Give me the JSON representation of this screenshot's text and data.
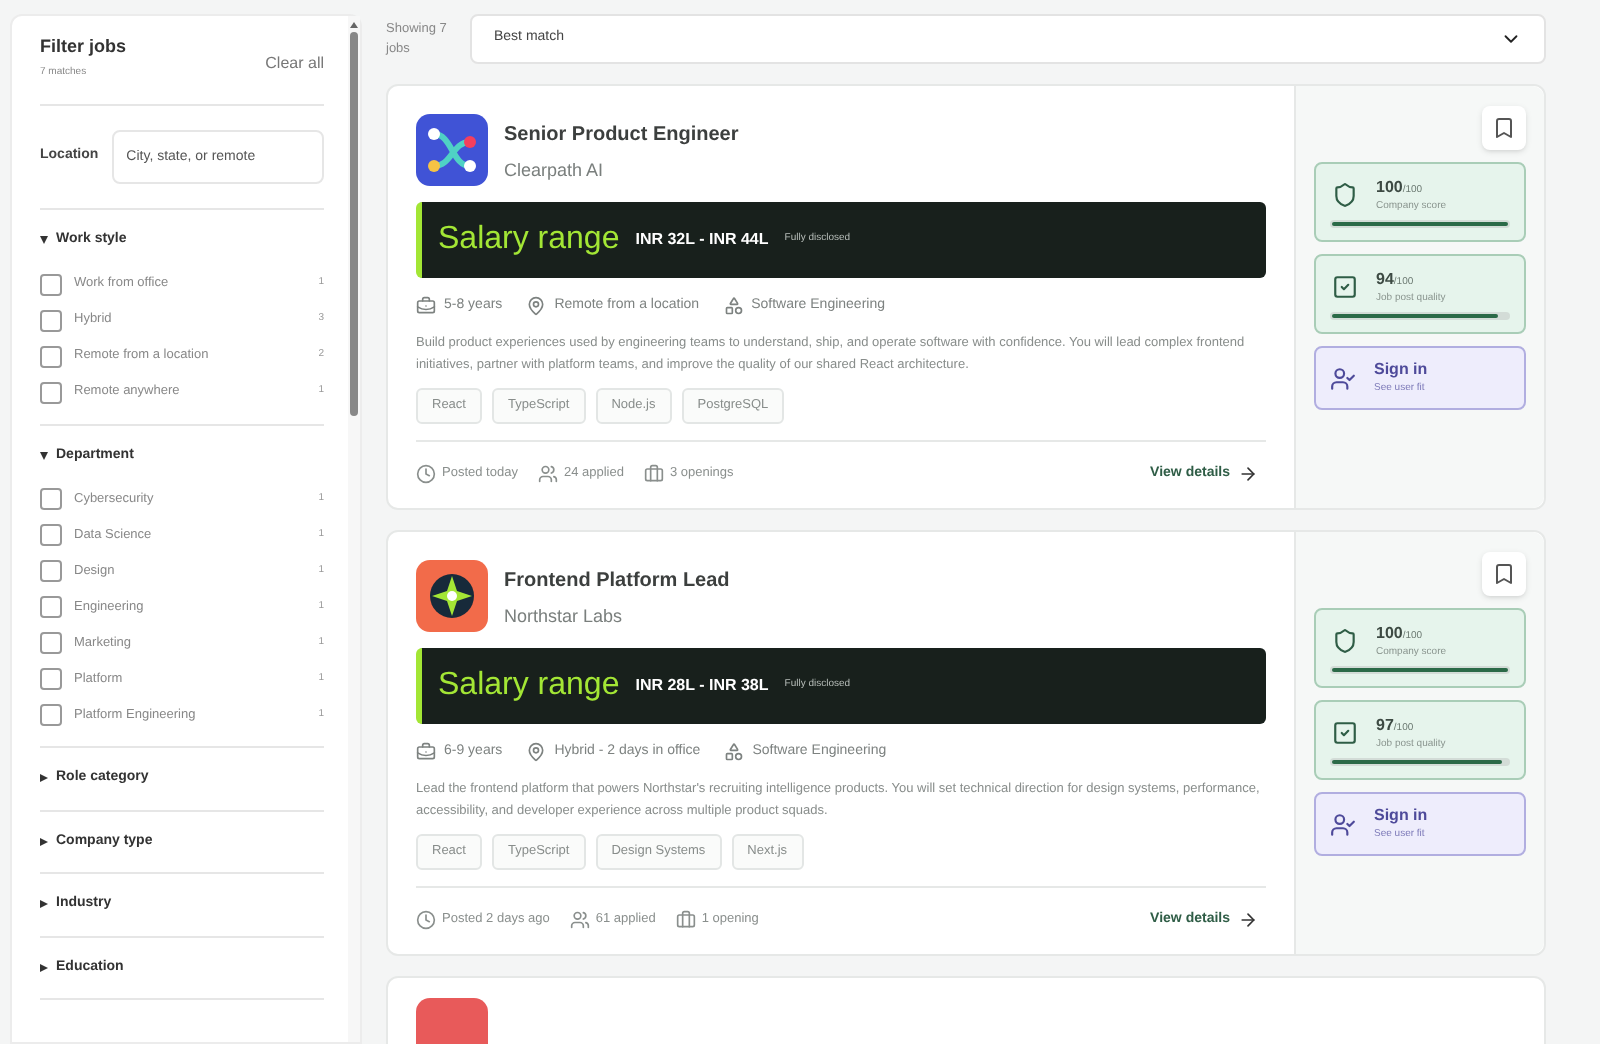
{
  "filters": {
    "title": "Filter jobs",
    "matches": "7 matches",
    "clear": "Clear all",
    "location": {
      "label": "Location",
      "placeholder": "City, state, or remote"
    },
    "sections": [
      {
        "title": "Work style",
        "expanded": true,
        "options": [
          {
            "label": "Work from office",
            "count": "1",
            "checked": false
          },
          {
            "label": "Hybrid",
            "count": "3",
            "checked": false
          },
          {
            "label": "Remote from a location",
            "count": "2",
            "checked": false
          },
          {
            "label": "Remote anywhere",
            "count": "1",
            "checked": false
          }
        ]
      },
      {
        "title": "Department",
        "expanded": true,
        "options": [
          {
            "label": "Cybersecurity",
            "count": "1",
            "checked": false
          },
          {
            "label": "Data Science",
            "count": "1",
            "checked": false
          },
          {
            "label": "Design",
            "count": "1",
            "checked": false
          },
          {
            "label": "Engineering",
            "count": "1",
            "checked": false
          },
          {
            "label": "Marketing",
            "count": "1",
            "checked": false
          },
          {
            "label": "Platform",
            "count": "1",
            "checked": false
          },
          {
            "label": "Platform Engineering",
            "count": "1",
            "checked": false
          }
        ]
      },
      {
        "title": "Role category",
        "expanded": false
      },
      {
        "title": "Company type",
        "expanded": false
      },
      {
        "title": "Industry",
        "expanded": false
      },
      {
        "title": "Education",
        "expanded": false
      }
    ]
  },
  "results": {
    "count": "Showing 7 jobs",
    "sort": "Best match"
  },
  "jobs": [
    {
      "kind": "flow",
      "title": "Senior Product Engineer",
      "company": "Clearpath AI",
      "salary_label": "Salary range",
      "salary": "INR 32L - INR 44L",
      "salary_note": "Fully disclosed",
      "experience": "5-8 years",
      "work_style": "Remote from a location",
      "category": "Software Engineering",
      "description": "Build product experiences used by engineering teams to understand, ship, and operate software with confidence. You will lead complex frontend initiatives, partner with platform teams, and improve the quality of our shared React architecture.",
      "skills": [
        "React",
        "TypeScript",
        "Node.js",
        "PostgreSQL"
      ],
      "posted": "Posted today",
      "applied": "24 applied",
      "openings": "3 openings",
      "details": "View details",
      "saved": false,
      "scores": [
        {
          "kind": "company",
          "value": "100",
          "max": "/100",
          "label": "Company score",
          "level": 1.0
        },
        {
          "kind": "quality",
          "value": "94",
          "max": "/100",
          "label": "Job post quality",
          "level": 0.94
        }
      ],
      "fit": {
        "title": "Sign in",
        "subtitle": "See user fit"
      }
    },
    {
      "kind": "star",
      "title": "Frontend Platform Lead",
      "company": "Northstar Labs",
      "salary_label": "Salary range",
      "salary": "INR 28L - INR 38L",
      "salary_note": "Fully disclosed",
      "experience": "6-9 years",
      "work_style": "Hybrid - 2 days in office",
      "category": "Software Engineering",
      "description": "Lead the frontend platform that powers Northstar's recruiting intelligence products. You will set technical direction for design systems, performance, accessibility, and developer experience across multiple product squads.",
      "skills": [
        "React",
        "TypeScript",
        "Design Systems",
        "Next.js"
      ],
      "posted": "Posted 2 days ago",
      "applied": "61 applied",
      "openings": "1 opening",
      "details": "View details",
      "saved": false,
      "scores": [
        {
          "kind": "company",
          "value": "100",
          "max": "/100",
          "label": "Company score",
          "level": 1.0
        },
        {
          "kind": "quality",
          "value": "97",
          "max": "/100",
          "label": "Job post quality",
          "level": 0.97
        }
      ],
      "fit": {
        "title": "Sign in",
        "subtitle": "See user fit"
      }
    }
  ]
}
